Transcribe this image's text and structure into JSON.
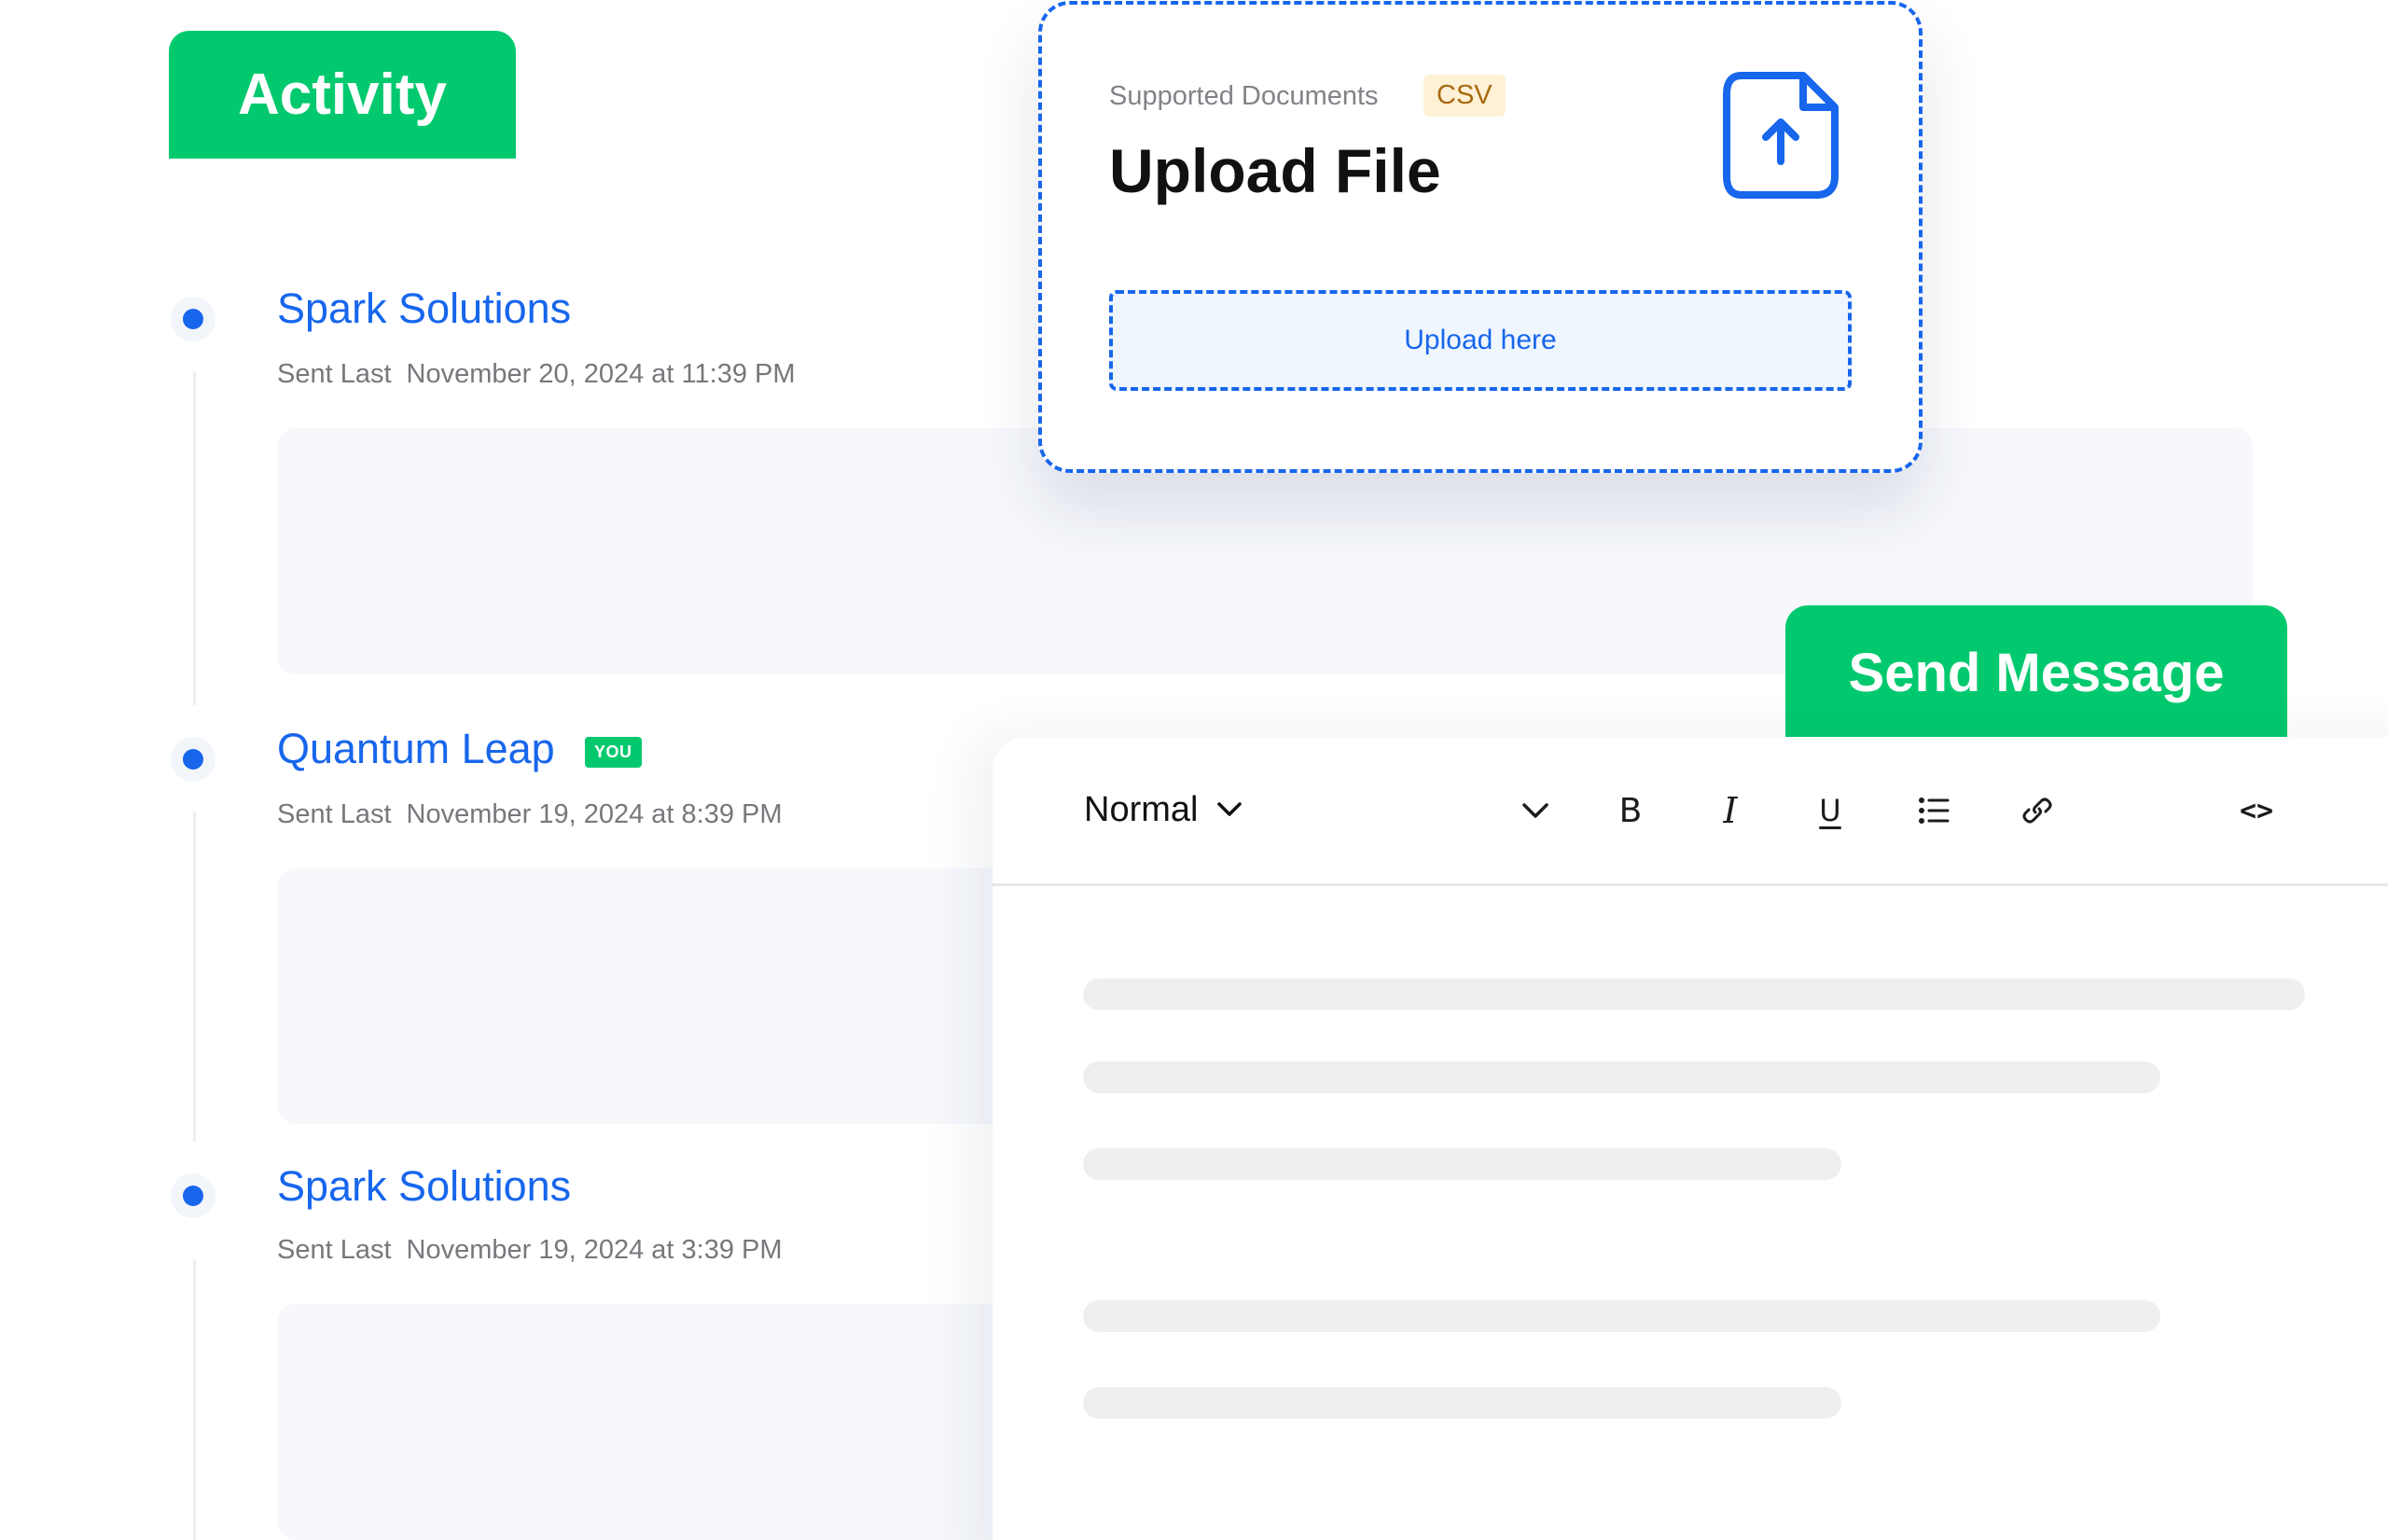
{
  "activity": {
    "title": "Activity",
    "entries": [
      {
        "name": "Spark Solutions",
        "badge": "",
        "sent_label": "Sent Last",
        "timestamp": "November 20, 2024 at 11:39 PM"
      },
      {
        "name": "Quantum Leap",
        "badge": "YOU",
        "sent_label": "Sent Last",
        "timestamp": "November 19, 2024 at 8:39 PM"
      },
      {
        "name": "Spark Solutions",
        "badge": "",
        "sent_label": "Sent Last",
        "timestamp": "November 19, 2024 at 3:39 PM"
      }
    ]
  },
  "upload": {
    "supported_label": "Supported Documents",
    "file_type": "CSV",
    "title": "Upload File",
    "dropzone_label": "Upload here",
    "icon": "file-upload-icon"
  },
  "composer": {
    "title": "Send Message",
    "format_value": "Normal",
    "toolbar": [
      {
        "name": "dropdown",
        "icon": "chevron-down-icon"
      },
      {
        "name": "bold",
        "label": "B"
      },
      {
        "name": "italic",
        "label": "I"
      },
      {
        "name": "underline",
        "label": "U"
      },
      {
        "name": "list",
        "icon": "bullet-list-icon"
      },
      {
        "name": "link",
        "icon": "link-icon"
      },
      {
        "name": "code",
        "label": "<>"
      }
    ]
  },
  "colors": {
    "accent_green": "#02C96E",
    "accent_blue": "#1766EC",
    "card_background": "#F6F8FC",
    "csv_badge_bg": "#FFF1D6"
  }
}
